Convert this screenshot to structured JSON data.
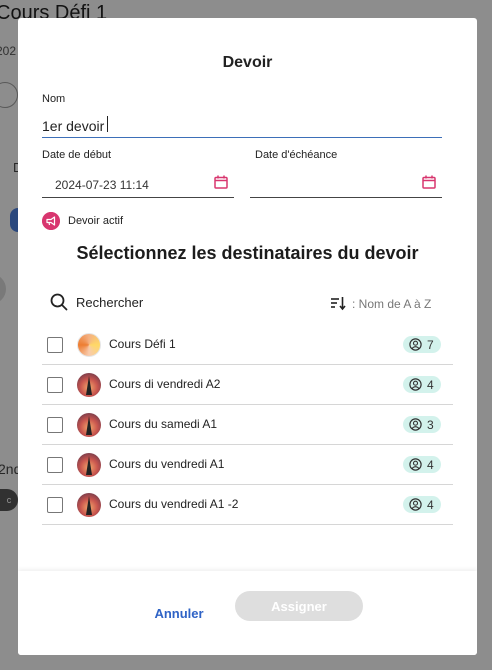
{
  "background": {
    "title": "Cours Défi 1",
    "subtitle_fragment": "202",
    "side_letter": "D",
    "section_fragment": "2nd",
    "avatar_letter": "c"
  },
  "modal": {
    "title": "Devoir",
    "name_label": "Nom",
    "name_value": "1er devoir",
    "start_date_label": "Date de début",
    "start_date_value": "2024-07-23 11:14",
    "due_date_label": "Date d'échéance",
    "due_date_value": "",
    "active_label": "Devoir actif",
    "section_title": "Sélectionnez les destinataires du devoir",
    "search_label": "Rechercher",
    "sort_label": ": Nom de A à Z",
    "recipients": [
      {
        "name": "Cours Défi 1",
        "count": "7",
        "avatar": "colorful"
      },
      {
        "name": "Cours di vendredi A2",
        "count": "4",
        "avatar": "eiffel"
      },
      {
        "name": "Cours du samedi A1",
        "count": "3",
        "avatar": "eiffel"
      },
      {
        "name": "Cours du vendredi A1",
        "count": "4",
        "avatar": "eiffel"
      },
      {
        "name": "Cours du vendredi A1 -2",
        "count": "4",
        "avatar": "eiffel"
      }
    ],
    "cancel_label": "Annuler",
    "assign_label": "Assigner"
  },
  "colors": {
    "accent_blue": "#2f63c6",
    "active_pink": "#d8366f",
    "badge_bg": "#d3f2ec",
    "disabled_button": "#dedede"
  },
  "icons": [
    "calendar-icon",
    "megaphone-icon",
    "search-icon",
    "sort-icon",
    "user-circle-icon"
  ]
}
